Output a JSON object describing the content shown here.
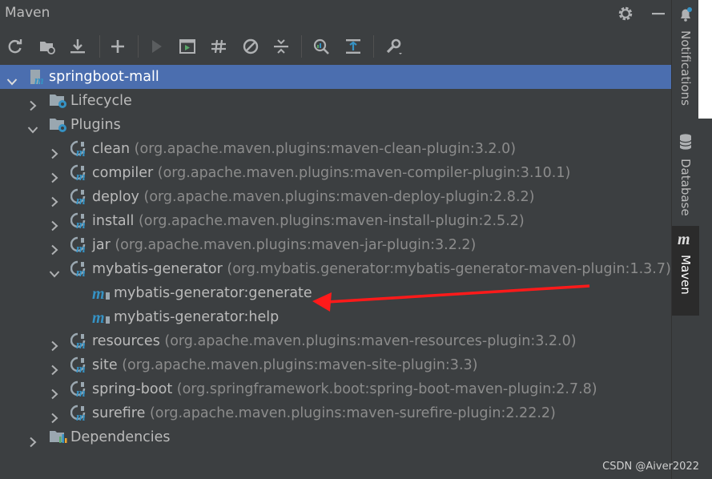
{
  "window": {
    "title": "Maven"
  },
  "toolbar": {
    "buttons": [
      {
        "icon": "reload-icon"
      },
      {
        "icon": "import-folder-icon"
      },
      {
        "icon": "download-sources-icon"
      },
      {
        "icon": "add-project-icon"
      },
      {
        "icon": "run-icon"
      },
      {
        "icon": "execute-goal-icon"
      },
      {
        "icon": "toggle-offline-icon"
      },
      {
        "icon": "skip-tests-icon"
      },
      {
        "icon": "collapse-all-icon"
      },
      {
        "icon": "analyze-dependencies-icon"
      },
      {
        "icon": "show-diagram-icon"
      },
      {
        "icon": "settings-wrench-icon"
      }
    ]
  },
  "tree": {
    "project": {
      "name": "springboot-mall"
    },
    "lifecycle": {
      "label": "Lifecycle"
    },
    "plugins_label": "Plugins",
    "plugins": [
      {
        "name": "clean",
        "coords": "(org.apache.maven.plugins:maven-clean-plugin:3.2.0)"
      },
      {
        "name": "compiler",
        "coords": "(org.apache.maven.plugins:maven-compiler-plugin:3.10.1)"
      },
      {
        "name": "deploy",
        "coords": "(org.apache.maven.plugins:maven-deploy-plugin:2.8.2)"
      },
      {
        "name": "install",
        "coords": "(org.apache.maven.plugins:maven-install-plugin:2.5.2)"
      },
      {
        "name": "jar",
        "coords": "(org.apache.maven.plugins:maven-jar-plugin:3.2.2)"
      },
      {
        "name": "mybatis-generator",
        "coords": "(org.mybatis.generator:mybatis-generator-maven-plugin:1.3.7)",
        "goals": [
          "mybatis-generator:generate",
          "mybatis-generator:help"
        ]
      },
      {
        "name": "resources",
        "coords": "(org.apache.maven.plugins:maven-resources-plugin:3.2.0)"
      },
      {
        "name": "site",
        "coords": "(org.apache.maven.plugins:maven-site-plugin:3.3)"
      },
      {
        "name": "spring-boot",
        "coords": "(org.springframework.boot:spring-boot-maven-plugin:2.7.8)"
      },
      {
        "name": "surefire",
        "coords": "(org.apache.maven.plugins:maven-surefire-plugin:2.22.2)"
      }
    ],
    "dependencies": {
      "label": "Dependencies"
    }
  },
  "side_tabs": [
    {
      "label": "Notifications",
      "icon": "bell-icon"
    },
    {
      "label": "Database",
      "icon": "database-icon"
    },
    {
      "label": "Maven",
      "icon": "maven-icon"
    }
  ],
  "watermark": "CSDN @Aiver2022",
  "colors": {
    "selection": "#4b6eaf",
    "annotation_arrow": "#ff1a1a",
    "maven_blue": "#3592c4"
  }
}
